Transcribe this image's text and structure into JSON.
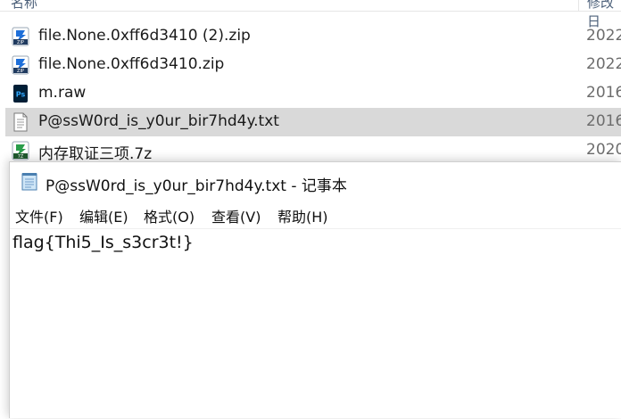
{
  "explorer": {
    "header": {
      "name_label": "名称",
      "date_label": "修改日"
    },
    "files": [
      {
        "name": "file.None.0xff6d3410 (2).zip",
        "date": "2022",
        "icon": "zip-archive-icon"
      },
      {
        "name": "file.None.0xff6d3410.zip",
        "date": "2022",
        "icon": "zip-archive-icon"
      },
      {
        "name": "m.raw",
        "date": "2016",
        "icon": "photoshop-file-icon"
      },
      {
        "name": "P@ssW0rd_is_y0ur_bir7hd4y.txt",
        "date": "2016",
        "icon": "text-file-icon",
        "selected": true
      },
      {
        "name": "内存取证三项.7z",
        "date": "2020",
        "icon": "7z-archive-icon"
      }
    ]
  },
  "notepad": {
    "title": "P@ssW0rd_is_y0ur_bir7hd4y.txt - 记事本",
    "menu": [
      "文件(F)",
      "编辑(E)",
      "格式(O)",
      "查看(V)",
      "帮助(H)"
    ],
    "content": "flag{Thi5_Is_s3cr3t!}"
  },
  "colors": {
    "selection": "#d9d9d9",
    "zip_blue": "#1e6fd9",
    "ps_blue": "#001e36",
    "ps_accent": "#31a8ff",
    "sevenzip_green": "#2a9d4b"
  }
}
